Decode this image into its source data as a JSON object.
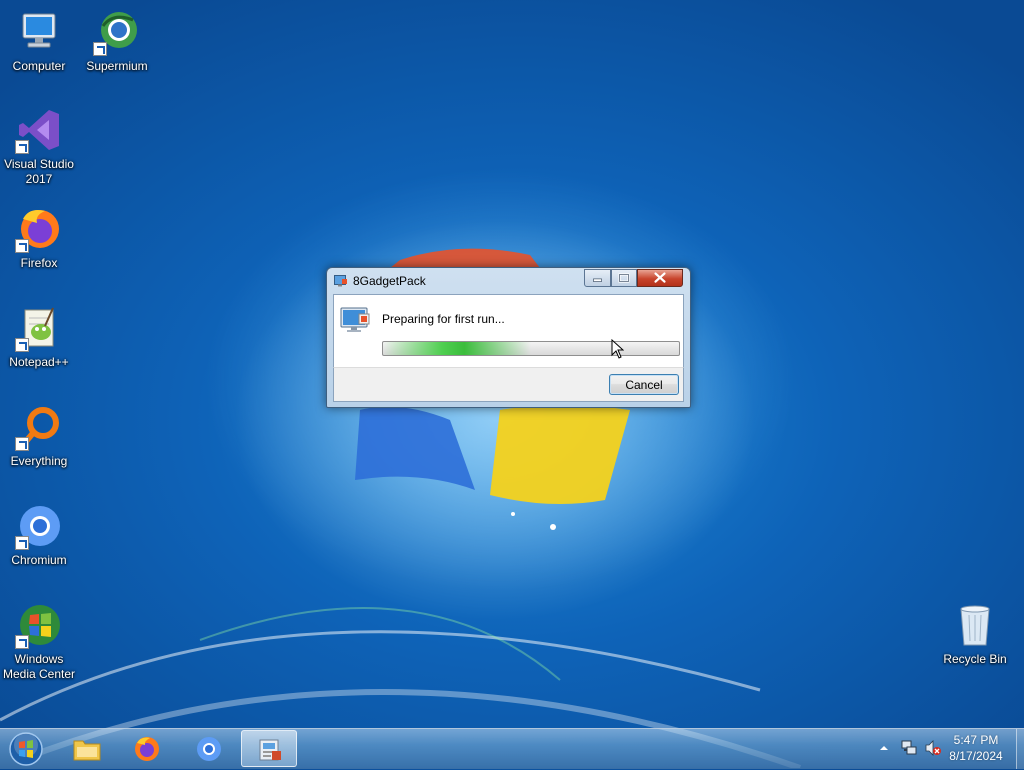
{
  "desktop": {
    "icons": [
      {
        "label": "Computer"
      },
      {
        "label": "Supermium"
      },
      {
        "label": "Visual Studio 2017"
      },
      {
        "label": "Firefox"
      },
      {
        "label": "Notepad++"
      },
      {
        "label": "Everything"
      },
      {
        "label": "Chromium"
      },
      {
        "label": "Windows Media Center"
      },
      {
        "label": "Recycle Bin"
      }
    ]
  },
  "dialog": {
    "title": "8GadgetPack",
    "message": "Preparing for first run...",
    "progress_fraction": 0.5,
    "cancel_label": "Cancel"
  },
  "taskbar": {
    "items": [
      {
        "icon": "start-orb-icon"
      },
      {
        "icon": "file-explorer-icon"
      },
      {
        "icon": "firefox-icon"
      },
      {
        "icon": "chromium-icon"
      },
      {
        "icon": "8gadgetpack-installer-icon",
        "active": true
      }
    ],
    "tray": {
      "icons": [
        "show-hidden-icons-icon",
        "network-icon",
        "volume-muted-icon"
      ],
      "time": "5:47 PM",
      "date": "8/17/2024"
    }
  },
  "colors": {
    "desktop_blue": "#0e63b8",
    "progress_green": "#3bbd3c",
    "close_red": "#c8442c"
  }
}
